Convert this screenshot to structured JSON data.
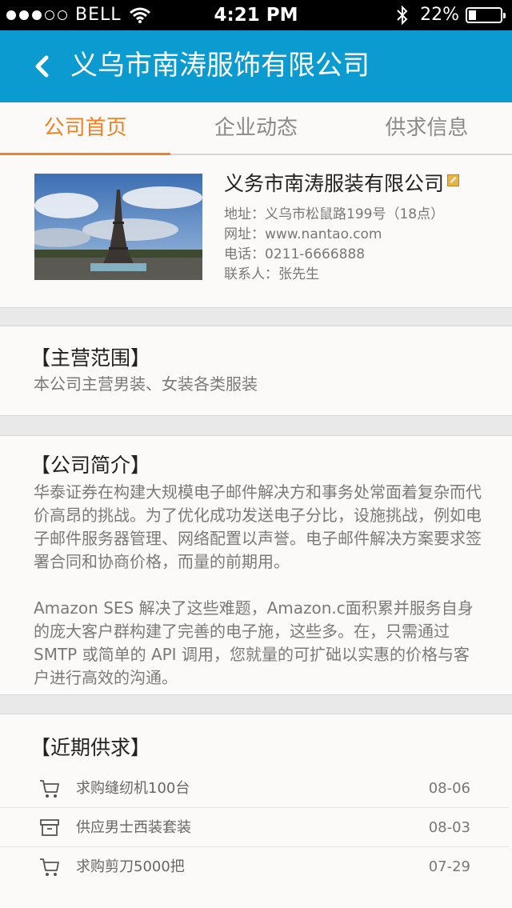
{
  "status_bar": {
    "carrier": "BELL",
    "time": "4:21 PM",
    "battery": "22%",
    "battery_level": 0.22,
    "signal_bars": 3
  },
  "nav": {
    "back_icon": "chevron-left-icon",
    "title": "义乌市南涛服饰有限公司"
  },
  "tabs": [
    {
      "label": "公司首页",
      "active": true
    },
    {
      "label": "企业动态",
      "active": false
    },
    {
      "label": "供求信息",
      "active": false
    }
  ],
  "company": {
    "name": "义务市南涛服装有限公司",
    "address": "地址：义乌市松鼠路199号（18点）",
    "website": "网址：www.nantao.com",
    "phone": "电话：0211-6666888",
    "contact": "联系人：张先生"
  },
  "scope": {
    "title": "【主营范围】",
    "body": "本公司主营男装、女装各类服装"
  },
  "intro": {
    "title": "【公司简介】",
    "paragraphs": [
      "华泰证券在构建大规模电子邮件解决方和事务处常面着复杂而代价高昂的挑战。为了优化成功发送电子分比，设施挑战，例如电子邮件服务器管理、网络配置以声誉。电子邮件解决方案要求签署合同和协商价格，而量的前期用。",
      "Amazon SES 解决了这些难题，Amazon.c面积累并服务自身的庞大客户群构建了完善的电子施，这些多。在，只需通过 SMTP 或简单的 API 调用，您就量的可扩础以实惠的价格与客户进行高效的沟通。"
    ]
  },
  "recent": {
    "title": "【近期供求】",
    "items": [
      {
        "icon": "cart-icon",
        "text": "求购缝纫机100台",
        "date": "08-06"
      },
      {
        "icon": "box-icon",
        "text": "供应男士西装套装",
        "date": "08-03"
      },
      {
        "icon": "cart-icon",
        "text": "求购剪刀5000把",
        "date": "07-29"
      }
    ]
  }
}
